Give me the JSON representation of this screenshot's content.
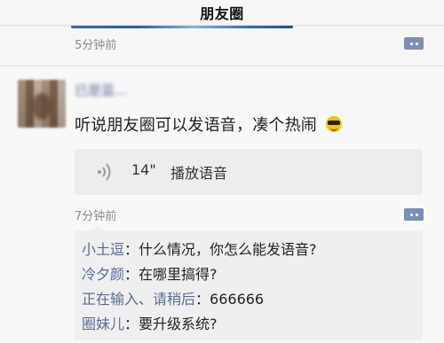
{
  "nav": {
    "title": "朋友圈"
  },
  "prev_post": {
    "time": "5分钟前",
    "more_icon": "more-icon"
  },
  "post": {
    "username_hint": "已是蓝...",
    "text": "听说朋友圈可以发语音，凑个热闹",
    "emoji": "sunglasses-emoji",
    "voice": {
      "duration": "14\"",
      "label": "播放语音",
      "icon": "voice-icon"
    },
    "time": "7分钟前",
    "more_icon": "more-icon",
    "comments": [
      {
        "name": "小土逗",
        "sep": "：",
        "text": "什么情况，你怎么能发语音?"
      },
      {
        "name": "冷夕颜",
        "sep": "：",
        "text": "在哪里搞得?"
      },
      {
        "name": "正在输入、请稍后",
        "sep": "：",
        "text": "666666"
      },
      {
        "name": "圈妹儿",
        "sep": "：",
        "text": "要升级系统?"
      }
    ]
  },
  "colors": {
    "link_blue": "#576b95",
    "more_btn": "#7d8eb6",
    "background": "#f8f8f8"
  }
}
